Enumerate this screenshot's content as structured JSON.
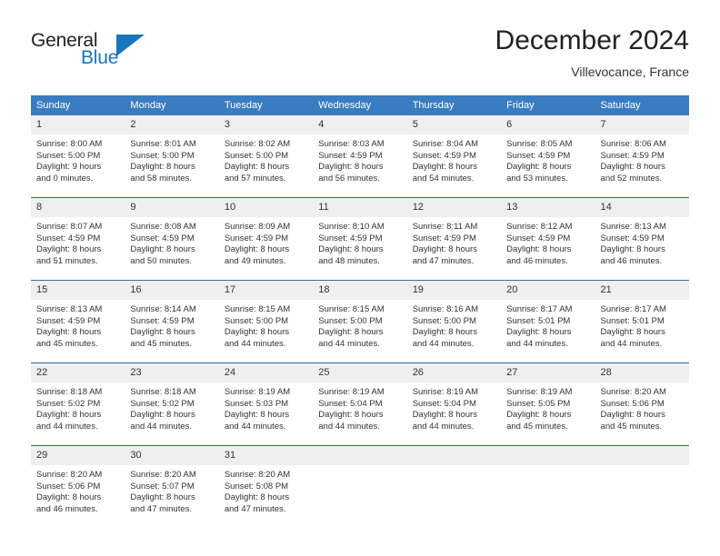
{
  "brand": {
    "name_top": "General",
    "name_bottom": "Blue",
    "triangle_color": "#1b75bb",
    "text_color": "#231f20"
  },
  "header": {
    "title": "December 2024",
    "subtitle": "Villevocance, France"
  },
  "theme": {
    "header_blue": "#3a7cc0",
    "row_divider": "#2f6ca8",
    "daynum_band": "#efefef",
    "text": "#333333"
  },
  "weekdays": [
    "Sunday",
    "Monday",
    "Tuesday",
    "Wednesday",
    "Thursday",
    "Friday",
    "Saturday"
  ],
  "weeks": [
    [
      {
        "day": "1",
        "sunrise": "Sunrise: 8:00 AM",
        "sunset": "Sunset: 5:00 PM",
        "daylight_1": "Daylight: 9 hours",
        "daylight_2": "and 0 minutes."
      },
      {
        "day": "2",
        "sunrise": "Sunrise: 8:01 AM",
        "sunset": "Sunset: 5:00 PM",
        "daylight_1": "Daylight: 8 hours",
        "daylight_2": "and 58 minutes."
      },
      {
        "day": "3",
        "sunrise": "Sunrise: 8:02 AM",
        "sunset": "Sunset: 5:00 PM",
        "daylight_1": "Daylight: 8 hours",
        "daylight_2": "and 57 minutes."
      },
      {
        "day": "4",
        "sunrise": "Sunrise: 8:03 AM",
        "sunset": "Sunset: 4:59 PM",
        "daylight_1": "Daylight: 8 hours",
        "daylight_2": "and 56 minutes."
      },
      {
        "day": "5",
        "sunrise": "Sunrise: 8:04 AM",
        "sunset": "Sunset: 4:59 PM",
        "daylight_1": "Daylight: 8 hours",
        "daylight_2": "and 54 minutes."
      },
      {
        "day": "6",
        "sunrise": "Sunrise: 8:05 AM",
        "sunset": "Sunset: 4:59 PM",
        "daylight_1": "Daylight: 8 hours",
        "daylight_2": "and 53 minutes."
      },
      {
        "day": "7",
        "sunrise": "Sunrise: 8:06 AM",
        "sunset": "Sunset: 4:59 PM",
        "daylight_1": "Daylight: 8 hours",
        "daylight_2": "and 52 minutes."
      }
    ],
    [
      {
        "day": "8",
        "sunrise": "Sunrise: 8:07 AM",
        "sunset": "Sunset: 4:59 PM",
        "daylight_1": "Daylight: 8 hours",
        "daylight_2": "and 51 minutes."
      },
      {
        "day": "9",
        "sunrise": "Sunrise: 8:08 AM",
        "sunset": "Sunset: 4:59 PM",
        "daylight_1": "Daylight: 8 hours",
        "daylight_2": "and 50 minutes."
      },
      {
        "day": "10",
        "sunrise": "Sunrise: 8:09 AM",
        "sunset": "Sunset: 4:59 PM",
        "daylight_1": "Daylight: 8 hours",
        "daylight_2": "and 49 minutes."
      },
      {
        "day": "11",
        "sunrise": "Sunrise: 8:10 AM",
        "sunset": "Sunset: 4:59 PM",
        "daylight_1": "Daylight: 8 hours",
        "daylight_2": "and 48 minutes."
      },
      {
        "day": "12",
        "sunrise": "Sunrise: 8:11 AM",
        "sunset": "Sunset: 4:59 PM",
        "daylight_1": "Daylight: 8 hours",
        "daylight_2": "and 47 minutes."
      },
      {
        "day": "13",
        "sunrise": "Sunrise: 8:12 AM",
        "sunset": "Sunset: 4:59 PM",
        "daylight_1": "Daylight: 8 hours",
        "daylight_2": "and 46 minutes."
      },
      {
        "day": "14",
        "sunrise": "Sunrise: 8:13 AM",
        "sunset": "Sunset: 4:59 PM",
        "daylight_1": "Daylight: 8 hours",
        "daylight_2": "and 46 minutes."
      }
    ],
    [
      {
        "day": "15",
        "sunrise": "Sunrise: 8:13 AM",
        "sunset": "Sunset: 4:59 PM",
        "daylight_1": "Daylight: 8 hours",
        "daylight_2": "and 45 minutes."
      },
      {
        "day": "16",
        "sunrise": "Sunrise: 8:14 AM",
        "sunset": "Sunset: 4:59 PM",
        "daylight_1": "Daylight: 8 hours",
        "daylight_2": "and 45 minutes."
      },
      {
        "day": "17",
        "sunrise": "Sunrise: 8:15 AM",
        "sunset": "Sunset: 5:00 PM",
        "daylight_1": "Daylight: 8 hours",
        "daylight_2": "and 44 minutes."
      },
      {
        "day": "18",
        "sunrise": "Sunrise: 8:15 AM",
        "sunset": "Sunset: 5:00 PM",
        "daylight_1": "Daylight: 8 hours",
        "daylight_2": "and 44 minutes."
      },
      {
        "day": "19",
        "sunrise": "Sunrise: 8:16 AM",
        "sunset": "Sunset: 5:00 PM",
        "daylight_1": "Daylight: 8 hours",
        "daylight_2": "and 44 minutes."
      },
      {
        "day": "20",
        "sunrise": "Sunrise: 8:17 AM",
        "sunset": "Sunset: 5:01 PM",
        "daylight_1": "Daylight: 8 hours",
        "daylight_2": "and 44 minutes."
      },
      {
        "day": "21",
        "sunrise": "Sunrise: 8:17 AM",
        "sunset": "Sunset: 5:01 PM",
        "daylight_1": "Daylight: 8 hours",
        "daylight_2": "and 44 minutes."
      }
    ],
    [
      {
        "day": "22",
        "sunrise": "Sunrise: 8:18 AM",
        "sunset": "Sunset: 5:02 PM",
        "daylight_1": "Daylight: 8 hours",
        "daylight_2": "and 44 minutes."
      },
      {
        "day": "23",
        "sunrise": "Sunrise: 8:18 AM",
        "sunset": "Sunset: 5:02 PM",
        "daylight_1": "Daylight: 8 hours",
        "daylight_2": "and 44 minutes."
      },
      {
        "day": "24",
        "sunrise": "Sunrise: 8:19 AM",
        "sunset": "Sunset: 5:03 PM",
        "daylight_1": "Daylight: 8 hours",
        "daylight_2": "and 44 minutes."
      },
      {
        "day": "25",
        "sunrise": "Sunrise: 8:19 AM",
        "sunset": "Sunset: 5:04 PM",
        "daylight_1": "Daylight: 8 hours",
        "daylight_2": "and 44 minutes."
      },
      {
        "day": "26",
        "sunrise": "Sunrise: 8:19 AM",
        "sunset": "Sunset: 5:04 PM",
        "daylight_1": "Daylight: 8 hours",
        "daylight_2": "and 44 minutes."
      },
      {
        "day": "27",
        "sunrise": "Sunrise: 8:19 AM",
        "sunset": "Sunset: 5:05 PM",
        "daylight_1": "Daylight: 8 hours",
        "daylight_2": "and 45 minutes."
      },
      {
        "day": "28",
        "sunrise": "Sunrise: 8:20 AM",
        "sunset": "Sunset: 5:06 PM",
        "daylight_1": "Daylight: 8 hours",
        "daylight_2": "and 45 minutes."
      }
    ],
    [
      {
        "day": "29",
        "sunrise": "Sunrise: 8:20 AM",
        "sunset": "Sunset: 5:06 PM",
        "daylight_1": "Daylight: 8 hours",
        "daylight_2": "and 46 minutes."
      },
      {
        "day": "30",
        "sunrise": "Sunrise: 8:20 AM",
        "sunset": "Sunset: 5:07 PM",
        "daylight_1": "Daylight: 8 hours",
        "daylight_2": "and 47 minutes."
      },
      {
        "day": "31",
        "sunrise": "Sunrise: 8:20 AM",
        "sunset": "Sunset: 5:08 PM",
        "daylight_1": "Daylight: 8 hours",
        "daylight_2": "and 47 minutes."
      },
      {
        "day": "",
        "sunrise": "",
        "sunset": "",
        "daylight_1": "",
        "daylight_2": ""
      },
      {
        "day": "",
        "sunrise": "",
        "sunset": "",
        "daylight_1": "",
        "daylight_2": ""
      },
      {
        "day": "",
        "sunrise": "",
        "sunset": "",
        "daylight_1": "",
        "daylight_2": ""
      },
      {
        "day": "",
        "sunrise": "",
        "sunset": "",
        "daylight_1": "",
        "daylight_2": ""
      }
    ]
  ]
}
